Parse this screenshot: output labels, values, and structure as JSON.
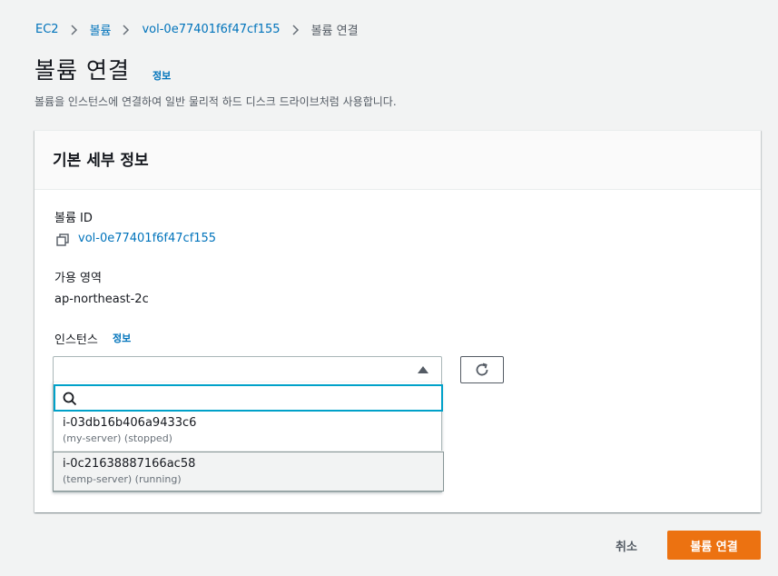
{
  "breadcrumb": {
    "items": [
      "EC2",
      "볼륨",
      "vol-0e77401f6f47cf155"
    ],
    "current": "볼륨 연결"
  },
  "header": {
    "title": "볼륨 연결",
    "info": "정보",
    "description": "볼륨을 인스턴스에 연결하여 일반 물리적 하드 디스크 드라이브처럼 사용합니다."
  },
  "panel": {
    "title": "기본 세부 정보",
    "volume_id_label": "볼륨 ID",
    "volume_id_value": "vol-0e77401f6f47cf155",
    "az_label": "가용 영역",
    "az_value": "ap-northeast-2c",
    "instance_label": "인스턴스",
    "instance_info": "정보",
    "instance_select_value": "",
    "search_value": "",
    "options": [
      {
        "id": "i-03db16b406a9433c6",
        "meta": "(my-server) (stopped)"
      },
      {
        "id": "i-0c21638887166ac58",
        "meta": "(temp-server) (running)"
      }
    ]
  },
  "footer": {
    "cancel": "취소",
    "submit": "볼륨 연결"
  },
  "colors": {
    "accent": "#ec7211",
    "link": "#0073bb",
    "focus": "#00a1c9"
  }
}
